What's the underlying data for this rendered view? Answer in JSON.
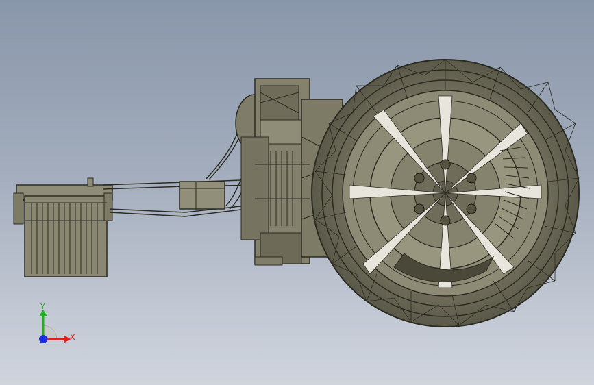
{
  "viewport": {
    "background_top": "#8997aa",
    "background_bottom": "#cfd4dd"
  },
  "model": {
    "description_icon": "wireframe-assembly",
    "stroke_color": "#2b2b22",
    "fill_color": "#7f7c6a",
    "light_fill_color": "#aaa893"
  },
  "triad": {
    "x_label": "X",
    "y_label": "Y",
    "x_color": "#e02020",
    "y_color": "#20b020",
    "z_color": "#1a2ee0"
  }
}
